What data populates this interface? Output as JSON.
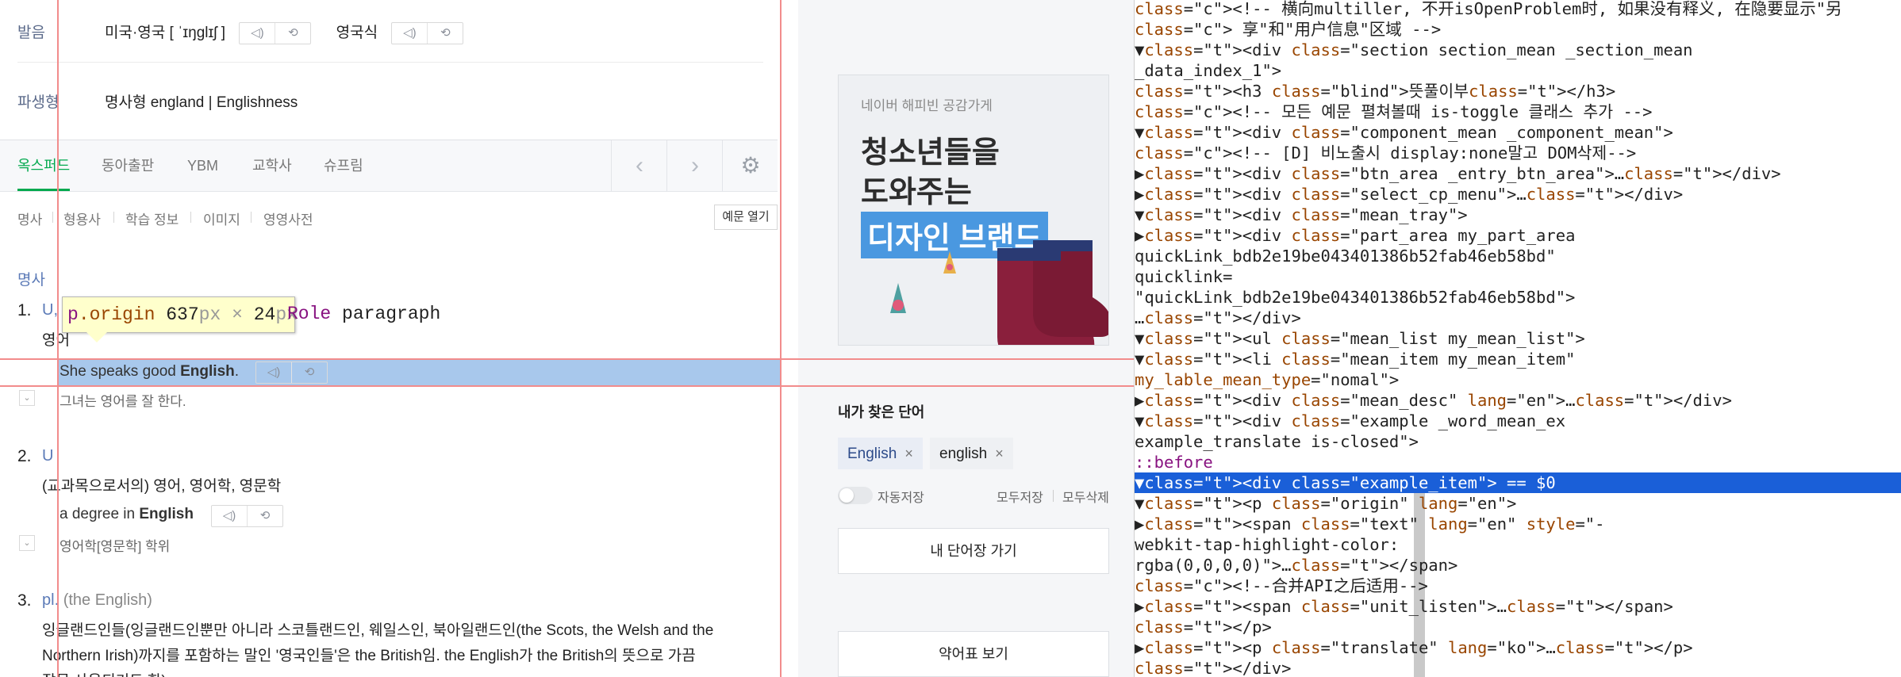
{
  "dictionary": {
    "pronunciation": {
      "label": "발음",
      "us_uk_text": "미국·영국 [ ˈɪŋɡlɪʃ ]",
      "uk_text": "영국식"
    },
    "derivative": {
      "label": "파생형",
      "text": "명사형 england | Englishness"
    },
    "tabs": [
      "옥스퍼드",
      "동아출판",
      "YBM",
      "교학사",
      "슈프림"
    ],
    "subnav": [
      "명사",
      "형용사",
      "학습 정보",
      "이미지",
      "영영사전"
    ],
    "open_examples_button": "예문 열기",
    "pos_label": "명사",
    "senses": [
      {
        "number": "1.",
        "grammar": "U,",
        "meaning": "영어",
        "example_en_prefix": "She speaks good ",
        "example_en_bold": "English",
        "example_en_suffix": ".",
        "example_kr": "그녀는 영어를 잘 한다."
      },
      {
        "number": "2.",
        "grammar": "U",
        "meaning": "(교과목으로서의) 영어, 영어학, 영문학",
        "example_en_prefix": "a degree in ",
        "example_en_bold": "English",
        "example_en_suffix": "",
        "example_kr": "영어학[영문학] 학위"
      },
      {
        "number": "3.",
        "grammar": "pl.",
        "grammar_note": "(the English)",
        "meaning_line1": "잉글랜드인들(잉글랜드인뿐만 아니라 스코틀랜드인, 웨일스인, 북아일랜드인(the Scots, the Welsh and the",
        "meaning_line2": "Northern Irish)까지를 포함하는 말인 '영국인들'은 the British임. the English가 the British의 뜻으로 가끔",
        "meaning_line3": "잘못 사용되기도 함)"
      }
    ],
    "inspect_tooltip": {
      "tag": "p",
      "class": ".origin",
      "width": "637",
      "height": "24",
      "unit": "px",
      "times": "×",
      "role_key": "Role",
      "role_value": "paragraph"
    }
  },
  "sidebar": {
    "ad": {
      "small": "네이버 해피빈 공감가게",
      "line1": "청소년들을",
      "line2": "도와주는",
      "line3": "디자인 브랜드"
    },
    "my_words_title": "내가 찾은 단어",
    "chips": [
      "English",
      "english"
    ],
    "chip_close": "×",
    "auto_save": "자동저장",
    "save_all": "모두저장",
    "delete_all": "모두삭제",
    "vocab_button": "내 단어장 가기",
    "abbrev_button": "약어표 보기"
  },
  "devtools": {
    "lines": [
      {
        "text": "  <!-- 横向multiller, 不开isOpenProblem时, 如果没有释义, 在隐要显示\"另"
      },
      {
        "text": "  享\"和\"用户信息\"区域 -->"
      },
      {
        "text": "▼<div class=\"section section_mean _section_mean"
      },
      {
        "text": " _data_index_1\">"
      },
      {
        "text": "    <h3 class=\"blind\">뜻풀이부</h3>"
      },
      {
        "text": "    <!-- 모든 예문 펼쳐볼때 is-toggle 클래스 추가 -->"
      },
      {
        "text": "  ▼<div class=\"component_mean _component_mean\">"
      },
      {
        "text": "      <!-- [D] 비노출시 display:none말고 DOM삭제-->"
      },
      {
        "text": "    ▶<div class=\"btn_area _entry_btn_area\">…</div>"
      },
      {
        "text": "    ▶<div class=\"select_cp_menu\">…</div>"
      },
      {
        "text": "    ▼<div class=\"mean_tray\">"
      },
      {
        "text": "      ▶<div class=\"part_area my_part_area"
      },
      {
        "text": "       quickLink_bdb2e19be043401386b52fab46eb58bd\""
      },
      {
        "text": "       quicklink="
      },
      {
        "text": "       \"quickLink_bdb2e19be043401386b52fab46eb58bd\">"
      },
      {
        "text": "       …</div>"
      },
      {
        "text": "      ▼<ul class=\"mean_list my_mean_list\">"
      },
      {
        "text": "        ▼<li class=\"mean_item my_mean_item\""
      },
      {
        "text": "         my_lable_mean_type=\"nomal\">"
      },
      {
        "text": "          ▶<div class=\"mean_desc\" lang=\"en\">…</div>"
      },
      {
        "text": "          ▼<div class=\"example _word_mean_ex"
      },
      {
        "text": "           example_translate is-closed\">"
      },
      {
        "text": "             ::before"
      },
      {
        "text": "            ▼<div class=\"example_item\"> == $0"
      },
      {
        "text": "              ▼<p class=\"origin\" lang=\"en\">"
      },
      {
        "text": "                ▶<span class=\"text\" lang=\"en\" style=\"-"
      },
      {
        "text": "                 webkit-tap-highlight-color:"
      },
      {
        "text": "                 rgba(0,0,0,0)\">…</span>"
      },
      {
        "text": "                  <!--合并API之后适用-->"
      },
      {
        "text": "                ▶<span class=\"unit_listen\">…</span>"
      },
      {
        "text": "                </p>"
      },
      {
        "text": "              ▶<p class=\"translate\" lang=\"ko\">…</p>"
      },
      {
        "text": "              </div>"
      }
    ],
    "selected_index": 23
  },
  "colors": {
    "accent_green": "#03a94f",
    "link_blue": "#5b7ab7",
    "guide_red": "#f28c8c",
    "selection_blue": "#1a5fd8"
  }
}
